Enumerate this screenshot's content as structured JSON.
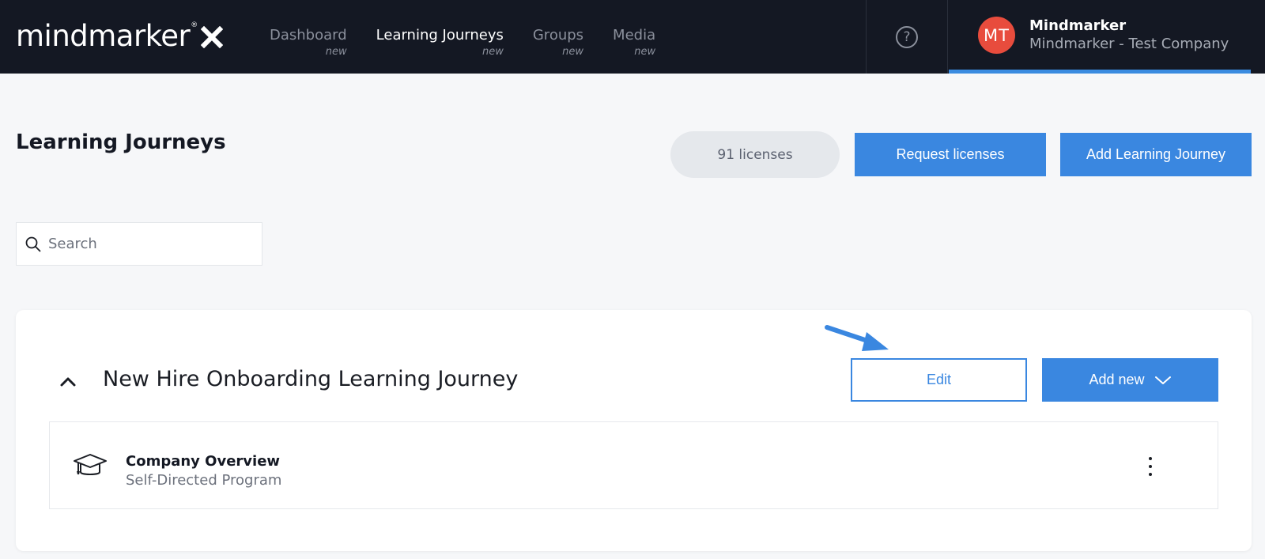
{
  "brand": {
    "name": "mindmarker",
    "registered": "®"
  },
  "nav": {
    "items": [
      {
        "label": "Dashboard",
        "badge": "new",
        "active": false
      },
      {
        "label": "Learning Journeys",
        "badge": "new",
        "active": true
      },
      {
        "label": "Groups",
        "badge": "new",
        "active": false
      },
      {
        "label": "Media",
        "badge": "new",
        "active": false
      }
    ]
  },
  "help": {
    "glyph": "?"
  },
  "user": {
    "initials": "MT",
    "name": "Mindmarker",
    "company": "Mindmarker - Test Company"
  },
  "page": {
    "title": "Learning Journeys",
    "licenses": "91 licenses",
    "request_label": "Request licenses",
    "add_journey_label": "Add Learning Journey"
  },
  "search": {
    "placeholder": "Search",
    "value": ""
  },
  "journey": {
    "title": "New Hire Onboarding Learning Journey",
    "edit_label": "Edit",
    "add_new_label": "Add new",
    "programs": [
      {
        "name": "Company Overview",
        "type": "Self-Directed Program"
      }
    ]
  },
  "colors": {
    "topbar": "#141823",
    "accent": "#3a87e0",
    "avatar": "#e84c3d",
    "background": "#f6f7f9"
  },
  "icons": [
    "logo-x-icon",
    "help-icon",
    "search-icon",
    "chevron-up-icon",
    "chevron-down-icon",
    "graduation-cap-icon",
    "kebab-menu-icon",
    "annotation-arrow-icon"
  ]
}
